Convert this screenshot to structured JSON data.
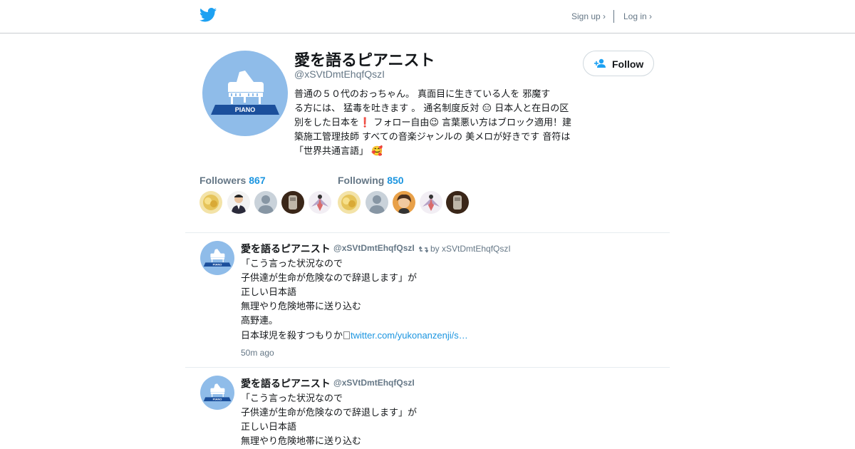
{
  "header": {
    "signup_label": "Sign up ›",
    "login_label": "Log in ›",
    "brand_color": "#1da1f2"
  },
  "profile": {
    "display_name": "愛を語るピアニスト",
    "handle": "@xSVtDmtEhqfQszI",
    "avatar_text": "PIANO",
    "follow_label": "Follow",
    "bio_lines": [
      "普通の５０代のおっちゃん。 真面目に生きている人を 邪魔す",
      "る方には、 猛毒を吐きます 。 通名制度反対 😑 日本人と在日の区",
      "別をした日本を❗ フォロー自由😉 言葉悪い方はブロック適用！建",
      "築施工管理技師 すべての音楽ジャンルの 美メロが好きです 音符は",
      "「世界共通言語」 🥰"
    ]
  },
  "followers": {
    "label": "Followers",
    "count": "867"
  },
  "following": {
    "label": "Following",
    "count": "850"
  },
  "tweets": [
    {
      "name": "愛を語るピアニスト",
      "handle": "@xSVtDmtEhqfQszI",
      "retweet_by": "by xSVtDmtEhqfQszI",
      "avatar_text": "PIANO",
      "lines": [
        "「こう言った状況なので",
        "子供達が生命が危険なので辞退します」が",
        "正しい日本語",
        "無理やり危険地帯に送り込む",
        "高野連。",
        "日本球児を殺すつもりか"
      ],
      "link": "twitter.com/yukonanzenji/s…",
      "time": "50m ago"
    },
    {
      "name": "愛を語るピアニスト",
      "handle": "@xSVtDmtEhqfQszI",
      "avatar_text": "PIANO",
      "lines": [
        "「こう言った状況なので",
        "子供達が生命が危険なので辞退します」が",
        "正しい日本語",
        "無理やり危険地帯に送り込む"
      ]
    }
  ]
}
